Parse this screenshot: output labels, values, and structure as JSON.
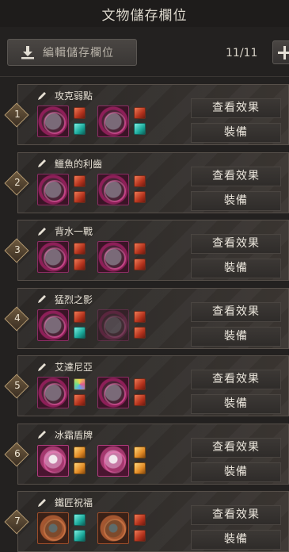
{
  "header": {
    "title": "文物儲存欄位"
  },
  "toolbar": {
    "edit_label": "編輯儲存欄位",
    "count": "11/11"
  },
  "slots": [
    {
      "number": "1",
      "name": "攻克弱點",
      "left_icon": "purple",
      "right_icon": "purple",
      "left_gems": [
        "red",
        "teal"
      ],
      "right_gems": [
        "red",
        "teal"
      ],
      "right_dim": false
    },
    {
      "number": "2",
      "name": "鱷魚的利齒",
      "left_icon": "purple",
      "right_icon": "purple",
      "left_gems": [
        "red",
        "red"
      ],
      "right_gems": [
        "red",
        "red"
      ],
      "right_dim": false
    },
    {
      "number": "3",
      "name": "背水一戰",
      "left_icon": "purple",
      "right_icon": "purple",
      "left_gems": [
        "red",
        "red"
      ],
      "right_gems": [
        "red",
        "red"
      ],
      "right_dim": false
    },
    {
      "number": "4",
      "name": "猛烈之影",
      "left_icon": "purple",
      "right_icon": "purple",
      "left_gems": [
        "red",
        "teal"
      ],
      "right_gems": [
        "red",
        "red"
      ],
      "right_dim": true
    },
    {
      "number": "5",
      "name": "艾達尼亞",
      "left_icon": "purple",
      "right_icon": "purple",
      "left_gems": [
        "multi",
        "red"
      ],
      "right_gems": [
        "red",
        "red"
      ],
      "right_dim": false
    },
    {
      "number": "6",
      "name": "冰霜盾牌",
      "left_icon": "pink",
      "right_icon": "pink",
      "left_gems": [
        "orange",
        "orange"
      ],
      "right_gems": [
        "orange",
        "orange"
      ],
      "right_dim": false
    },
    {
      "number": "7",
      "name": "鐵匠祝福",
      "left_icon": "brown",
      "right_icon": "brown",
      "left_gems": [
        "teal",
        "teal"
      ],
      "right_gems": [
        "red",
        "red"
      ],
      "right_dim": false
    }
  ],
  "labels": {
    "view": "查看效果",
    "equip": "裝備"
  }
}
